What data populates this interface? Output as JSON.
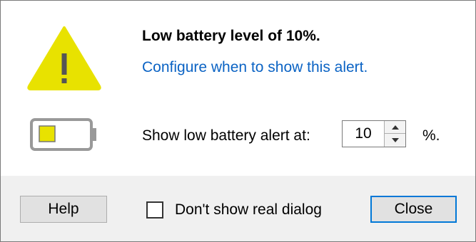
{
  "dialog": {
    "title": "Low battery level of 10%.",
    "configure_link": "Configure when to show this alert.",
    "alert_label": "Show low battery alert at:",
    "alert_value": "10",
    "percent_symbol": "%."
  },
  "footer": {
    "help_label": "Help",
    "checkbox_label": "Don't show real dialog",
    "checkbox_checked": false,
    "close_label": "Close"
  },
  "icons": {
    "warning": "warning-triangle-icon",
    "battery": "battery-low-icon",
    "spin_up": "spinner-up-icon",
    "spin_down": "spinner-down-icon"
  },
  "colors": {
    "warning_fill": "#e8e200",
    "link": "#0b63c4",
    "focus_border": "#0078d7",
    "footer_bg": "#f0f0f0"
  }
}
